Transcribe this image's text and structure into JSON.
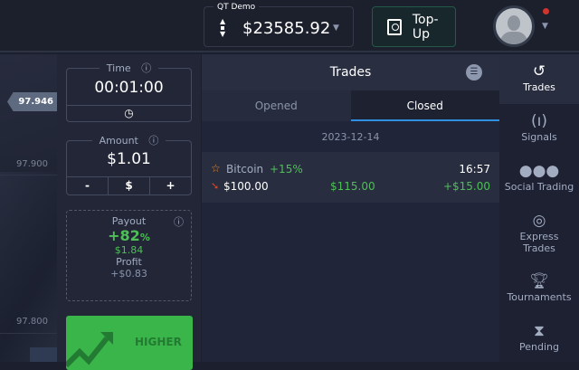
{
  "header": {
    "account_label": "QT Demo",
    "balance": "$23585.92",
    "topup_label": "Top-Up"
  },
  "chart": {
    "current_price": "97.946",
    "ticks": [
      "97.900",
      "97.800"
    ]
  },
  "time": {
    "label": "Time",
    "value": "00:01:00"
  },
  "amount": {
    "label": "Amount",
    "value": "$1.01",
    "minus": "-",
    "currency": "$",
    "plus": "+"
  },
  "payout": {
    "label": "Payout",
    "percent": "+82",
    "percent_sign": "%",
    "amount": "$1.84",
    "profit_label": "Profit",
    "profit": "+$0.83"
  },
  "higher_label": "HIGHER",
  "trades": {
    "title": "Trades",
    "tabs": [
      "Opened",
      "Closed"
    ],
    "date": "2023-12-14",
    "items": [
      {
        "asset": "Bitcoin",
        "payout": "+15%",
        "time": "16:57",
        "invest": "$100.00",
        "result": "$115.00",
        "profit": "+$15.00"
      }
    ]
  },
  "nav": [
    "Trades",
    "Signals",
    "Social Trading",
    "Express Trades",
    "Tournaments",
    "Pending"
  ],
  "colors": {
    "green": "#4fbf57",
    "accent": "#2f8fe0",
    "down": "#e8401c"
  }
}
